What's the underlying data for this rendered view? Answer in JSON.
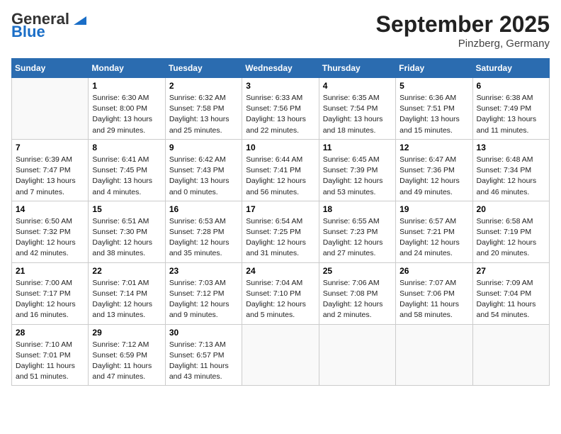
{
  "header": {
    "logo_general": "General",
    "logo_blue": "Blue",
    "month_title": "September 2025",
    "location": "Pinzberg, Germany"
  },
  "weekdays": [
    "Sunday",
    "Monday",
    "Tuesday",
    "Wednesday",
    "Thursday",
    "Friday",
    "Saturday"
  ],
  "weeks": [
    [
      {
        "day": "",
        "sunrise": "",
        "sunset": "",
        "daylight": ""
      },
      {
        "day": "1",
        "sunrise": "Sunrise: 6:30 AM",
        "sunset": "Sunset: 8:00 PM",
        "daylight": "Daylight: 13 hours and 29 minutes."
      },
      {
        "day": "2",
        "sunrise": "Sunrise: 6:32 AM",
        "sunset": "Sunset: 7:58 PM",
        "daylight": "Daylight: 13 hours and 25 minutes."
      },
      {
        "day": "3",
        "sunrise": "Sunrise: 6:33 AM",
        "sunset": "Sunset: 7:56 PM",
        "daylight": "Daylight: 13 hours and 22 minutes."
      },
      {
        "day": "4",
        "sunrise": "Sunrise: 6:35 AM",
        "sunset": "Sunset: 7:54 PM",
        "daylight": "Daylight: 13 hours and 18 minutes."
      },
      {
        "day": "5",
        "sunrise": "Sunrise: 6:36 AM",
        "sunset": "Sunset: 7:51 PM",
        "daylight": "Daylight: 13 hours and 15 minutes."
      },
      {
        "day": "6",
        "sunrise": "Sunrise: 6:38 AM",
        "sunset": "Sunset: 7:49 PM",
        "daylight": "Daylight: 13 hours and 11 minutes."
      }
    ],
    [
      {
        "day": "7",
        "sunrise": "Sunrise: 6:39 AM",
        "sunset": "Sunset: 7:47 PM",
        "daylight": "Daylight: 13 hours and 7 minutes."
      },
      {
        "day": "8",
        "sunrise": "Sunrise: 6:41 AM",
        "sunset": "Sunset: 7:45 PM",
        "daylight": "Daylight: 13 hours and 4 minutes."
      },
      {
        "day": "9",
        "sunrise": "Sunrise: 6:42 AM",
        "sunset": "Sunset: 7:43 PM",
        "daylight": "Daylight: 13 hours and 0 minutes."
      },
      {
        "day": "10",
        "sunrise": "Sunrise: 6:44 AM",
        "sunset": "Sunset: 7:41 PM",
        "daylight": "Daylight: 12 hours and 56 minutes."
      },
      {
        "day": "11",
        "sunrise": "Sunrise: 6:45 AM",
        "sunset": "Sunset: 7:39 PM",
        "daylight": "Daylight: 12 hours and 53 minutes."
      },
      {
        "day": "12",
        "sunrise": "Sunrise: 6:47 AM",
        "sunset": "Sunset: 7:36 PM",
        "daylight": "Daylight: 12 hours and 49 minutes."
      },
      {
        "day": "13",
        "sunrise": "Sunrise: 6:48 AM",
        "sunset": "Sunset: 7:34 PM",
        "daylight": "Daylight: 12 hours and 46 minutes."
      }
    ],
    [
      {
        "day": "14",
        "sunrise": "Sunrise: 6:50 AM",
        "sunset": "Sunset: 7:32 PM",
        "daylight": "Daylight: 12 hours and 42 minutes."
      },
      {
        "day": "15",
        "sunrise": "Sunrise: 6:51 AM",
        "sunset": "Sunset: 7:30 PM",
        "daylight": "Daylight: 12 hours and 38 minutes."
      },
      {
        "day": "16",
        "sunrise": "Sunrise: 6:53 AM",
        "sunset": "Sunset: 7:28 PM",
        "daylight": "Daylight: 12 hours and 35 minutes."
      },
      {
        "day": "17",
        "sunrise": "Sunrise: 6:54 AM",
        "sunset": "Sunset: 7:25 PM",
        "daylight": "Daylight: 12 hours and 31 minutes."
      },
      {
        "day": "18",
        "sunrise": "Sunrise: 6:55 AM",
        "sunset": "Sunset: 7:23 PM",
        "daylight": "Daylight: 12 hours and 27 minutes."
      },
      {
        "day": "19",
        "sunrise": "Sunrise: 6:57 AM",
        "sunset": "Sunset: 7:21 PM",
        "daylight": "Daylight: 12 hours and 24 minutes."
      },
      {
        "day": "20",
        "sunrise": "Sunrise: 6:58 AM",
        "sunset": "Sunset: 7:19 PM",
        "daylight": "Daylight: 12 hours and 20 minutes."
      }
    ],
    [
      {
        "day": "21",
        "sunrise": "Sunrise: 7:00 AM",
        "sunset": "Sunset: 7:17 PM",
        "daylight": "Daylight: 12 hours and 16 minutes."
      },
      {
        "day": "22",
        "sunrise": "Sunrise: 7:01 AM",
        "sunset": "Sunset: 7:14 PM",
        "daylight": "Daylight: 12 hours and 13 minutes."
      },
      {
        "day": "23",
        "sunrise": "Sunrise: 7:03 AM",
        "sunset": "Sunset: 7:12 PM",
        "daylight": "Daylight: 12 hours and 9 minutes."
      },
      {
        "day": "24",
        "sunrise": "Sunrise: 7:04 AM",
        "sunset": "Sunset: 7:10 PM",
        "daylight": "Daylight: 12 hours and 5 minutes."
      },
      {
        "day": "25",
        "sunrise": "Sunrise: 7:06 AM",
        "sunset": "Sunset: 7:08 PM",
        "daylight": "Daylight: 12 hours and 2 minutes."
      },
      {
        "day": "26",
        "sunrise": "Sunrise: 7:07 AM",
        "sunset": "Sunset: 7:06 PM",
        "daylight": "Daylight: 11 hours and 58 minutes."
      },
      {
        "day": "27",
        "sunrise": "Sunrise: 7:09 AM",
        "sunset": "Sunset: 7:04 PM",
        "daylight": "Daylight: 11 hours and 54 minutes."
      }
    ],
    [
      {
        "day": "28",
        "sunrise": "Sunrise: 7:10 AM",
        "sunset": "Sunset: 7:01 PM",
        "daylight": "Daylight: 11 hours and 51 minutes."
      },
      {
        "day": "29",
        "sunrise": "Sunrise: 7:12 AM",
        "sunset": "Sunset: 6:59 PM",
        "daylight": "Daylight: 11 hours and 47 minutes."
      },
      {
        "day": "30",
        "sunrise": "Sunrise: 7:13 AM",
        "sunset": "Sunset: 6:57 PM",
        "daylight": "Daylight: 11 hours and 43 minutes."
      },
      {
        "day": "",
        "sunrise": "",
        "sunset": "",
        "daylight": ""
      },
      {
        "day": "",
        "sunrise": "",
        "sunset": "",
        "daylight": ""
      },
      {
        "day": "",
        "sunrise": "",
        "sunset": "",
        "daylight": ""
      },
      {
        "day": "",
        "sunrise": "",
        "sunset": "",
        "daylight": ""
      }
    ]
  ]
}
